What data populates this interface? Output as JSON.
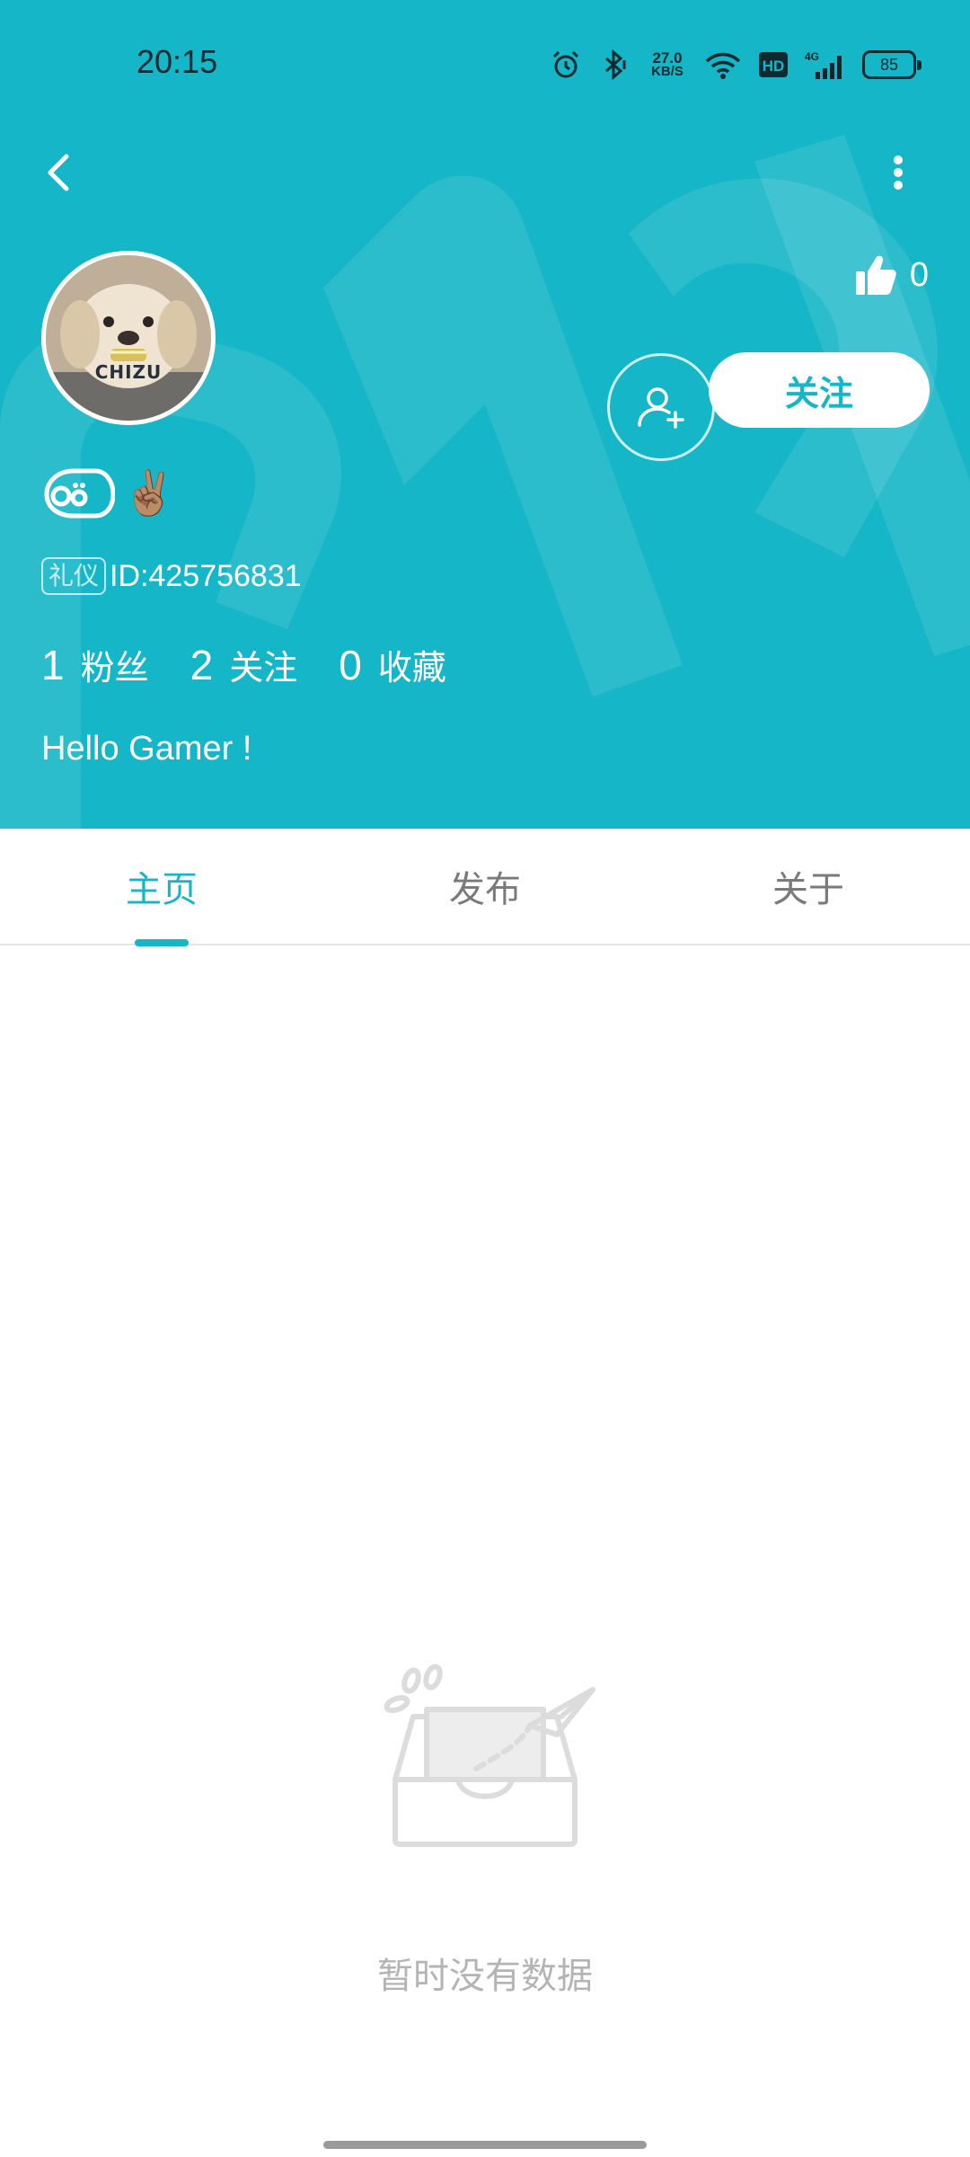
{
  "status_bar": {
    "time": "20:15",
    "speed_value": "27.0",
    "speed_unit": "KB/S",
    "hd_label": "HD",
    "network_label": "4G",
    "battery": "85"
  },
  "header": {
    "background_color": "#15b6c7",
    "avatar_caption": "CHIZU",
    "like_count": "0",
    "follow_label": "关注",
    "badge_label": "礼仪",
    "user_id": "ID:425756831",
    "emoji": "✌🏽",
    "stats": [
      {
        "value": "1",
        "label": "粉丝"
      },
      {
        "value": "2",
        "label": "关注"
      },
      {
        "value": "0",
        "label": "收藏"
      }
    ],
    "bio": "Hello Gamer !"
  },
  "tabs": [
    {
      "label": "主页",
      "active": true
    },
    {
      "label": "发布",
      "active": false
    },
    {
      "label": "关于",
      "active": false
    }
  ],
  "empty_state": {
    "text": "暂时没有数据"
  }
}
